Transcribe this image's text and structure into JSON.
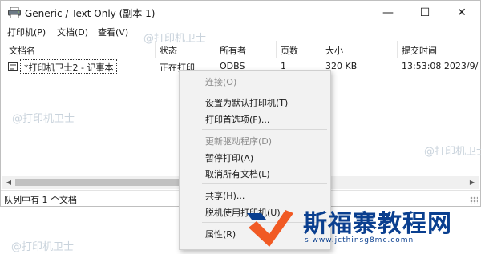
{
  "window": {
    "title": "Generic / Text Only (副本 1)",
    "controls": {
      "minimize": "—",
      "maximize": "☐",
      "close": "✕"
    }
  },
  "menubar": {
    "items": [
      "打印机(P)",
      "文档(D)",
      "查看(V)"
    ]
  },
  "columns": [
    "文档名",
    "状态",
    "所有者",
    "页数",
    "大小",
    "提交时间"
  ],
  "rows": [
    {
      "name": "*打印机卫士2 - 记事本",
      "status": "正在打印",
      "owner": "ODBS",
      "pages": "1",
      "size": "320 KB",
      "submitted": "13:53:08   2023/9/"
    }
  ],
  "status_bar": {
    "text": "队列中有 1 个文档"
  },
  "context_menu": {
    "items": [
      {
        "label": "连接(O)",
        "disabled": true
      },
      {
        "label": "设置为默认打印机(T)",
        "disabled": false
      },
      {
        "label": "打印首选项(F)...",
        "disabled": false
      },
      {
        "label": "更新驱动程序(D)",
        "disabled": true
      },
      {
        "label": "暂停打印(A)",
        "disabled": false
      },
      {
        "label": "取消所有文档(L)",
        "disabled": false
      },
      {
        "label": "共享(H)...",
        "disabled": false
      },
      {
        "label": "脱机使用打印机(U)",
        "disabled": false
      },
      {
        "label": "属性(R)",
        "disabled": false
      }
    ]
  },
  "watermark": {
    "text": "@打印机卫士"
  },
  "logo": {
    "name": "斯福寨教程网",
    "url": "s www.jcthinsg8mc.comn"
  },
  "colors": {
    "logo_blue": "#0a3f8f",
    "logo_orange": "#f15a24",
    "watermark": "#c9d3dc"
  }
}
